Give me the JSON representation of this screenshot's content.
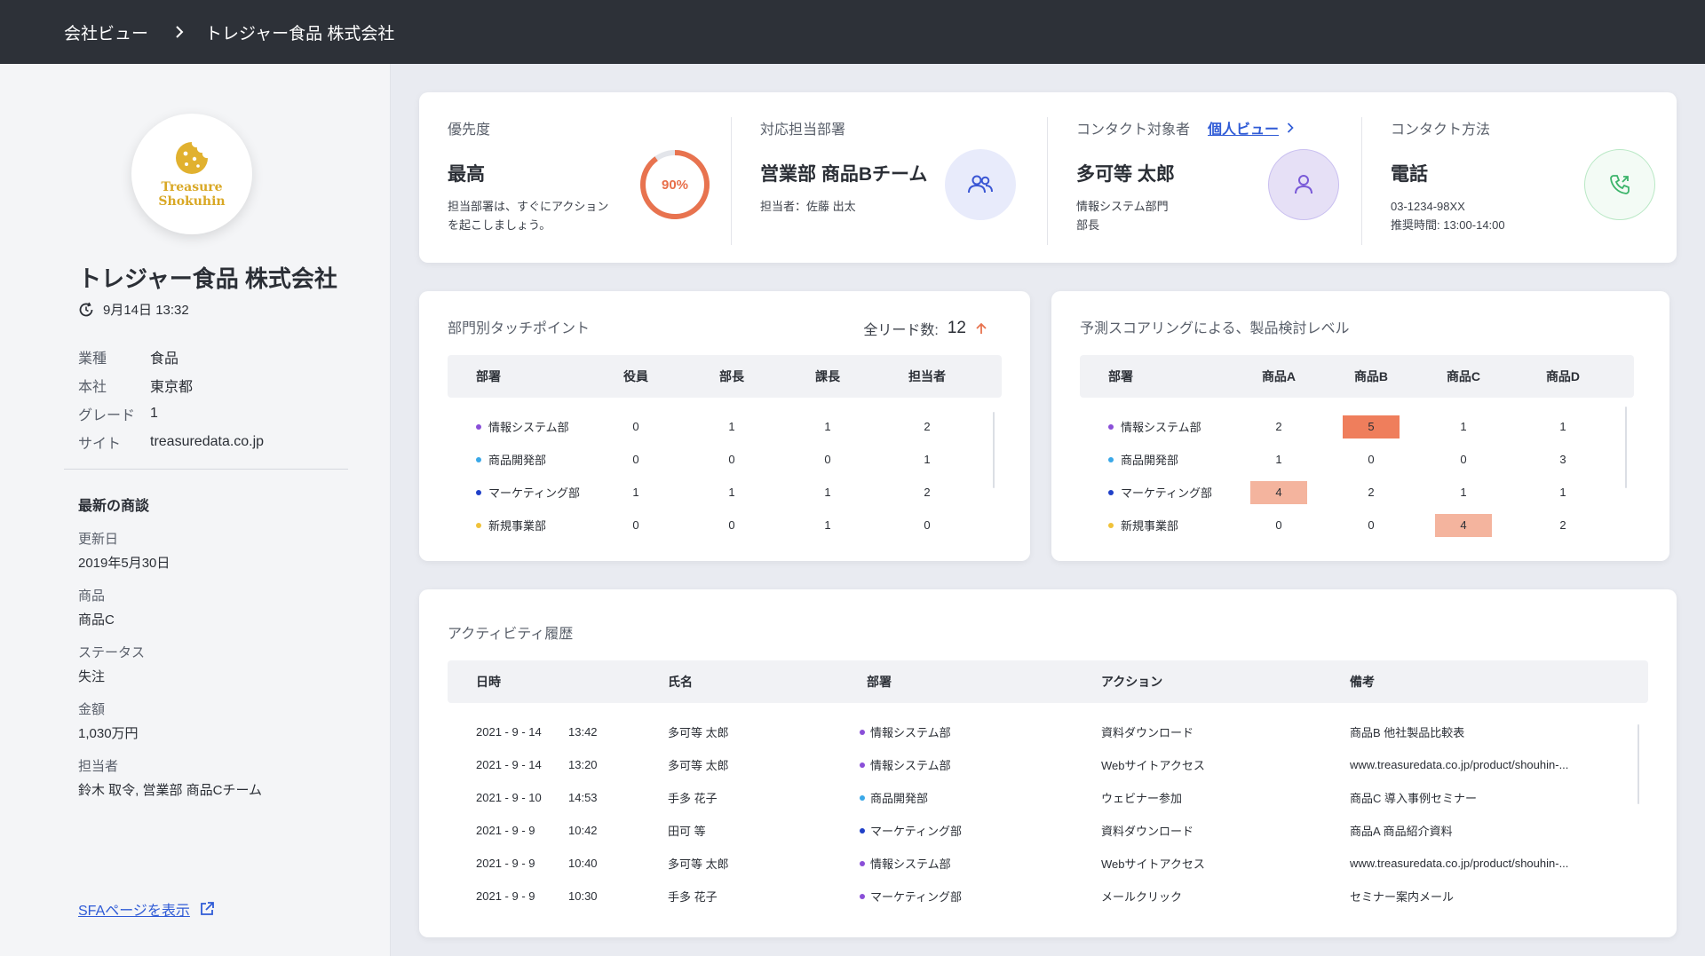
{
  "header": {
    "breadcrumb_root": "会社ビュー",
    "breadcrumb_current": "トレジャー食品 株式会社"
  },
  "sidebar": {
    "logo_line1": "Treasure",
    "logo_line2": "Shokuhin",
    "company_name": "トレジャー食品 株式会社",
    "timestamp": "9月14日 13:32",
    "info": [
      {
        "key": "業種",
        "value": "食品"
      },
      {
        "key": "本社",
        "value": "東京都"
      },
      {
        "key": "グレード",
        "value": "1"
      },
      {
        "key": "サイト",
        "value": "treasuredata.co.jp"
      }
    ],
    "deal_heading": "最新の商談",
    "deal": [
      {
        "key": "更新日",
        "value": "2019年5月30日"
      },
      {
        "key": "商品",
        "value": "商品C"
      },
      {
        "key": "ステータス",
        "value": "失注"
      },
      {
        "key": "金額",
        "value": "1,030万円"
      },
      {
        "key": "担当者",
        "value": "鈴木 取令, 営業部 商品Cチーム"
      }
    ],
    "sfa_link": "SFAページを表示"
  },
  "kpis": {
    "priority": {
      "label": "優先度",
      "value": "最高",
      "sub1": "担当部署は、すぐにアクション",
      "sub2": "を起こしましょう。",
      "percent_label": "90%",
      "percent": 0.9,
      "ring_color": "#e8734f"
    },
    "department": {
      "label": "対応担当部署",
      "value": "営業部 商品Bチーム",
      "sub1": "担当者：佐藤 出太"
    },
    "contact": {
      "label": "コンタクト対象者",
      "link": "個人ビュー",
      "value": "多可等 太郎",
      "sub1": "情報システム部門",
      "sub2": "部長"
    },
    "method": {
      "label": "コンタクト方法",
      "value": "電話",
      "sub1": "03-1234-98XX",
      "sub2": "推奨時間: 13:00-14:00"
    }
  },
  "touchpoints": {
    "title": "部門別タッチポイント",
    "lead_label": "全リード数:",
    "lead_count": "12",
    "columns": [
      "部署",
      "役員",
      "部長",
      "課長",
      "担当者"
    ],
    "rows": [
      {
        "dept": "情報システム部",
        "color": "#8a4fd8",
        "values": [
          "0",
          "1",
          "1",
          "2"
        ]
      },
      {
        "dept": "商品開発部",
        "color": "#3aa8e8",
        "values": [
          "0",
          "0",
          "0",
          "1"
        ]
      },
      {
        "dept": "マーケティング部",
        "color": "#2040c8",
        "values": [
          "1",
          "1",
          "1",
          "2"
        ]
      },
      {
        "dept": "新規事業部",
        "color": "#f0c23a",
        "values": [
          "0",
          "0",
          "1",
          "0"
        ]
      }
    ]
  },
  "scoring": {
    "title": "予測スコアリングによる、製品検討レベル",
    "columns": [
      "部署",
      "商品A",
      "商品B",
      "商品C",
      "商品D"
    ],
    "rows": [
      {
        "dept": "情報システム部",
        "color": "#8a4fd8",
        "values": [
          "2",
          "5",
          "1",
          "1"
        ],
        "highlight": [
          0,
          2,
          0,
          0
        ]
      },
      {
        "dept": "商品開発部",
        "color": "#3aa8e8",
        "values": [
          "1",
          "0",
          "0",
          "3"
        ],
        "highlight": [
          0,
          0,
          0,
          0
        ]
      },
      {
        "dept": "マーケティング部",
        "color": "#2040c8",
        "values": [
          "4",
          "2",
          "1",
          "1"
        ],
        "highlight": [
          1,
          0,
          0,
          0
        ]
      },
      {
        "dept": "新規事業部",
        "color": "#f0c23a",
        "values": [
          "0",
          "0",
          "4",
          "2"
        ],
        "highlight": [
          0,
          0,
          1,
          0
        ]
      }
    ],
    "highlight_colors": [
      "",
      "#f4b49e",
      "#ef7e5c"
    ]
  },
  "activity": {
    "title": "アクティビティ履歴",
    "columns": [
      "日時",
      "氏名",
      "部署",
      "アクション",
      "備考"
    ],
    "rows": [
      {
        "date": "2021 - 9 - 14",
        "time": "13:42",
        "name": "多可等 太郎",
        "dept": "情報システム部",
        "color": "#8a4fd8",
        "action": "資料ダウンロード",
        "note": "商品B 他社製品比較表"
      },
      {
        "date": "2021 - 9 - 14",
        "time": "13:20",
        "name": "多可等 太郎",
        "dept": "情報システム部",
        "color": "#8a4fd8",
        "action": "Webサイトアクセス",
        "note": "www.treasuredata.co.jp/product/shouhin-..."
      },
      {
        "date": "2021 - 9 - 10",
        "time": "14:53",
        "name": "手多 花子",
        "dept": "商品開発部",
        "color": "#3aa8e8",
        "action": "ウェビナー参加",
        "note": "商品C 導入事例セミナー"
      },
      {
        "date": "2021 - 9 -  9",
        "time": "10:42",
        "name": "田可 等",
        "dept": "マーケティング部",
        "color": "#2040c8",
        "action": "資料ダウンロード",
        "note": "商品A 商品紹介資料"
      },
      {
        "date": "2021 - 9 - 9",
        "time": "10:40",
        "name": "多可等 太郎",
        "dept": "情報システム部",
        "color": "#8a4fd8",
        "action": "Webサイトアクセス",
        "note": "www.treasuredata.co.jp/product/shouhin-..."
      },
      {
        "date": "2021 - 9 - 9",
        "time": "10:30",
        "name": "手多 花子",
        "dept": "マーケティング部",
        "color": "#8a4fd8",
        "action": "メールクリック",
        "note": "セミナー案内メール"
      }
    ]
  }
}
